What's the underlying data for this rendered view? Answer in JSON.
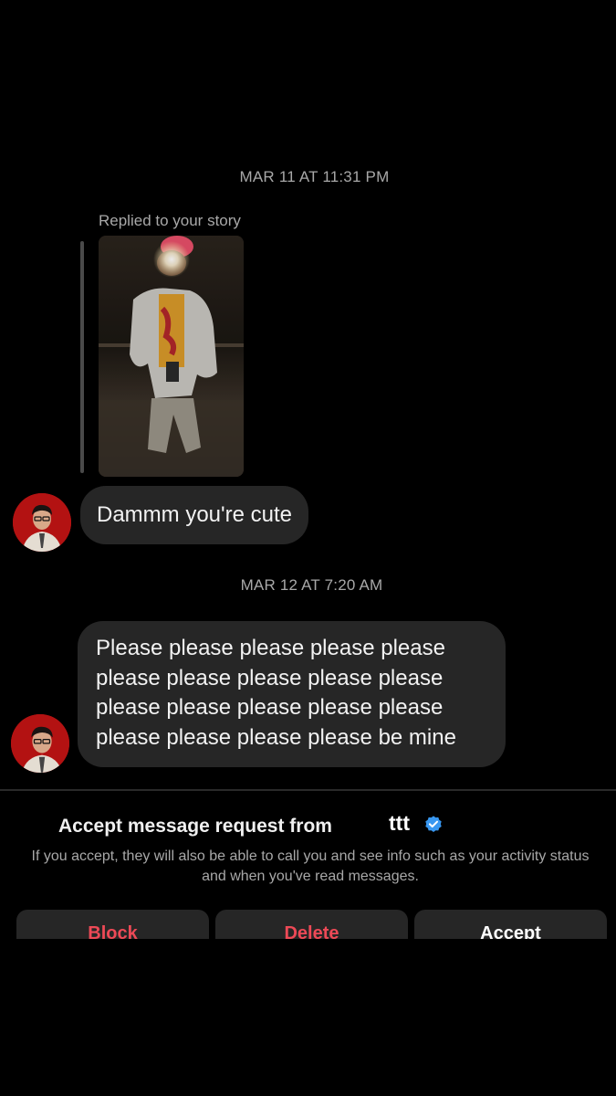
{
  "conversation": {
    "timestamps": [
      "MAR 11 AT 11:31 PM",
      "MAR 12 AT 7:20 AM"
    ],
    "story_reply": {
      "label": "Replied to your story"
    },
    "messages": [
      {
        "text": "Dammm you're cute"
      },
      {
        "text": "Please please please please please\nplease please please please please\nplease please please please please\nplease please please please be mine"
      }
    ]
  },
  "request": {
    "title": "Accept message request from",
    "username": "ttt",
    "verified_icon": "verified-badge-icon",
    "body": "If you accept, they will also be able to call you and see info such as your activity status and when you've read messages.",
    "buttons": {
      "block": "Block",
      "delete": "Delete",
      "accept": "Accept"
    }
  },
  "colors": {
    "background": "#000000",
    "bubble": "#262626",
    "destructive": "#ed4956",
    "verified": "#3897f0",
    "avatar_bg": "#b31212"
  }
}
